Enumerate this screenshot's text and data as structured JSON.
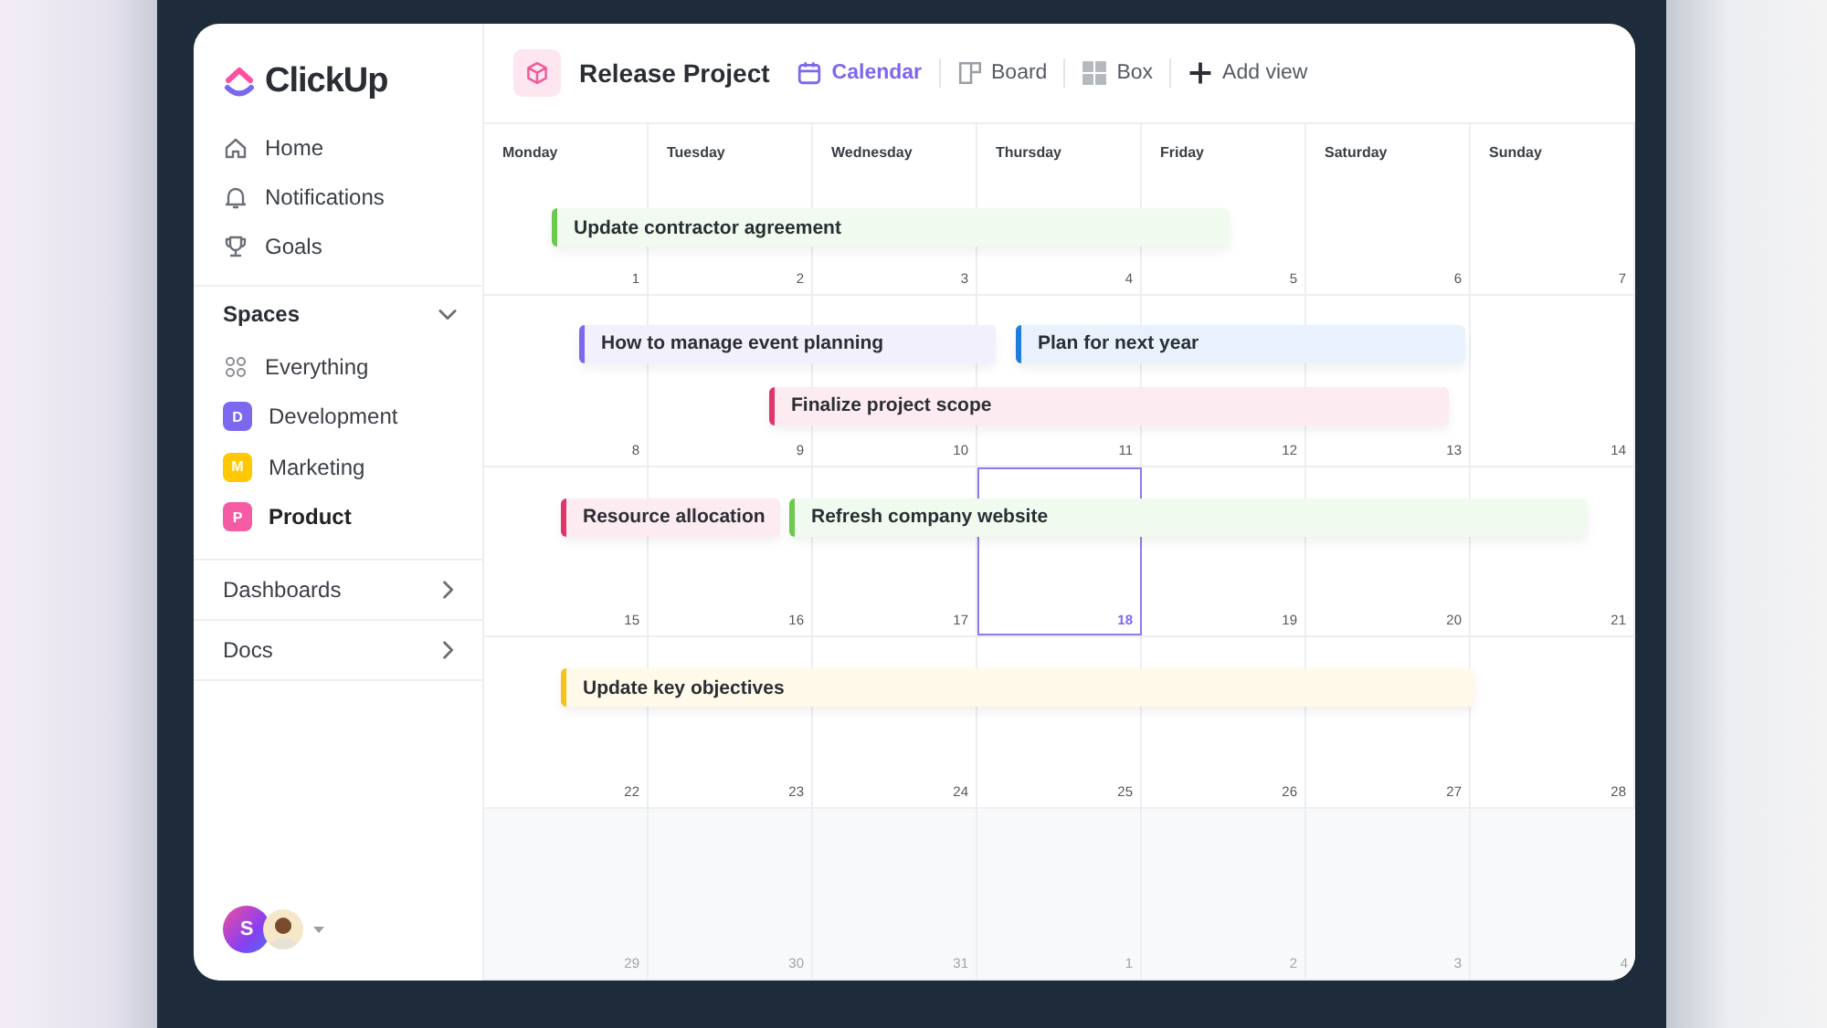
{
  "logo": {
    "text": "ClickUp"
  },
  "nav": [
    {
      "label": "Home"
    },
    {
      "label": "Notifications"
    },
    {
      "label": "Goals"
    }
  ],
  "spaces": {
    "title": "Spaces",
    "expanded": true,
    "items": [
      {
        "kind": "all",
        "label": "Everything",
        "selected": false
      },
      {
        "kind": "space",
        "badge": "D",
        "label": "Development",
        "color": "#7b68ee",
        "selected": false
      },
      {
        "kind": "space",
        "badge": "M",
        "label": "Marketing",
        "color": "#ffc800",
        "selected": false
      },
      {
        "kind": "space",
        "badge": "P",
        "label": "Product",
        "color": "#f45ba3",
        "selected": true
      }
    ]
  },
  "sections": [
    {
      "label": "Dashboards",
      "expanded": false
    },
    {
      "label": "Docs",
      "expanded": false
    }
  ],
  "user": {
    "initial": "S"
  },
  "header": {
    "title": "Release Project",
    "views": [
      {
        "kind": "calendar",
        "label": "Calendar",
        "selected": true
      },
      {
        "kind": "board",
        "label": "Board",
        "selected": false
      },
      {
        "kind": "box",
        "label": "Box",
        "selected": false
      },
      {
        "kind": "add",
        "label": "Add view",
        "selected": false
      }
    ]
  },
  "calendar": {
    "weekdays": [
      "Monday",
      "Tuesday",
      "Wednesday",
      "Thursday",
      "Friday",
      "Saturday",
      "Sunday"
    ],
    "weeks": [
      {
        "days": [
          {
            "date": "1",
            "muted": false,
            "selected": false
          },
          {
            "date": "2",
            "muted": false,
            "selected": false
          },
          {
            "date": "3",
            "muted": false,
            "selected": false
          },
          {
            "date": "4",
            "muted": false,
            "selected": false
          },
          {
            "date": "5",
            "muted": false,
            "selected": false
          },
          {
            "date": "6",
            "muted": false,
            "selected": false
          },
          {
            "date": "7",
            "muted": false,
            "selected": false
          }
        ],
        "events": [
          {
            "title": "Update contractor agreement",
            "color": "#6bc950"
          }
        ]
      },
      {
        "days": [
          {
            "date": "8",
            "muted": false,
            "selected": false
          },
          {
            "date": "9",
            "muted": false,
            "selected": false
          },
          {
            "date": "10",
            "muted": false,
            "selected": false
          },
          {
            "date": "11",
            "muted": false,
            "selected": false
          },
          {
            "date": "12",
            "muted": false,
            "selected": false
          },
          {
            "date": "13",
            "muted": false,
            "selected": false
          },
          {
            "date": "14",
            "muted": false,
            "selected": false
          }
        ],
        "events": [
          {
            "title": "How to manage event planning",
            "color": "#7b68ee"
          },
          {
            "title": "Plan for next year",
            "color": "#1e7ee0"
          },
          {
            "title": "Finalize project scope",
            "color": "#e0356a"
          }
        ]
      },
      {
        "days": [
          {
            "date": "15",
            "muted": false,
            "selected": false
          },
          {
            "date": "16",
            "muted": false,
            "selected": false
          },
          {
            "date": "17",
            "muted": false,
            "selected": false
          },
          {
            "date": "18",
            "muted": false,
            "selected": true
          },
          {
            "date": "19",
            "muted": false,
            "selected": false
          },
          {
            "date": "20",
            "muted": false,
            "selected": false
          },
          {
            "date": "21",
            "muted": false,
            "selected": false
          }
        ],
        "events": [
          {
            "title": "Resource allocation",
            "color": "#e0356a"
          },
          {
            "title": "Refresh company website",
            "color": "#6bc950"
          }
        ]
      },
      {
        "days": [
          {
            "date": "22",
            "muted": false,
            "selected": false
          },
          {
            "date": "23",
            "muted": false,
            "selected": false
          },
          {
            "date": "24",
            "muted": false,
            "selected": false
          },
          {
            "date": "25",
            "muted": false,
            "selected": false
          },
          {
            "date": "26",
            "muted": false,
            "selected": false
          },
          {
            "date": "27",
            "muted": false,
            "selected": false
          },
          {
            "date": "28",
            "muted": false,
            "selected": false
          }
        ],
        "events": [
          {
            "title": "Update key objectives",
            "color": "#f5c21b"
          }
        ]
      },
      {
        "days": [
          {
            "date": "29",
            "muted": true,
            "selected": false
          },
          {
            "date": "30",
            "muted": true,
            "selected": false
          },
          {
            "date": "31",
            "muted": true,
            "selected": false
          },
          {
            "date": "1",
            "muted": true,
            "selected": false
          },
          {
            "date": "2",
            "muted": true,
            "selected": false
          },
          {
            "date": "3",
            "muted": true,
            "selected": false
          },
          {
            "date": "4",
            "muted": true,
            "selected": false
          }
        ]
      }
    ]
  }
}
